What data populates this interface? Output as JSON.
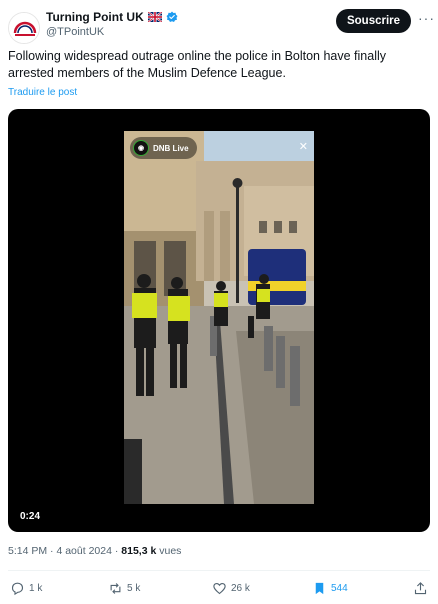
{
  "author": {
    "display_name": "Turning Point UK",
    "handle": "@TPointUK",
    "avatar_icon": "turning-point-uk-logo",
    "flag_icon": "union-jack-flag-icon",
    "verified_icon": "verified-badge-icon"
  },
  "header": {
    "subscribe_label": "Souscrire",
    "more_icon": "more-options-icon"
  },
  "post": {
    "text": "Following widespread outrage online the police in Bolton have finally arrested members of the Muslim Defence League.",
    "translate_label": "Traduire le post"
  },
  "video": {
    "channel_label": "DNB Live",
    "elapsed": "0:24",
    "close_icon": "close-icon"
  },
  "meta": {
    "time": "5:14 PM",
    "separator": "·",
    "date": "4 août 2024",
    "views_count": "815,3 k",
    "views_label": "vues"
  },
  "actions": {
    "replies": "1 k",
    "reposts": "5 k",
    "likes": "26 k",
    "bookmarks": "544"
  },
  "colors": {
    "accent": "#1d9bf0",
    "text": "#0f1419",
    "muted": "#536471"
  }
}
